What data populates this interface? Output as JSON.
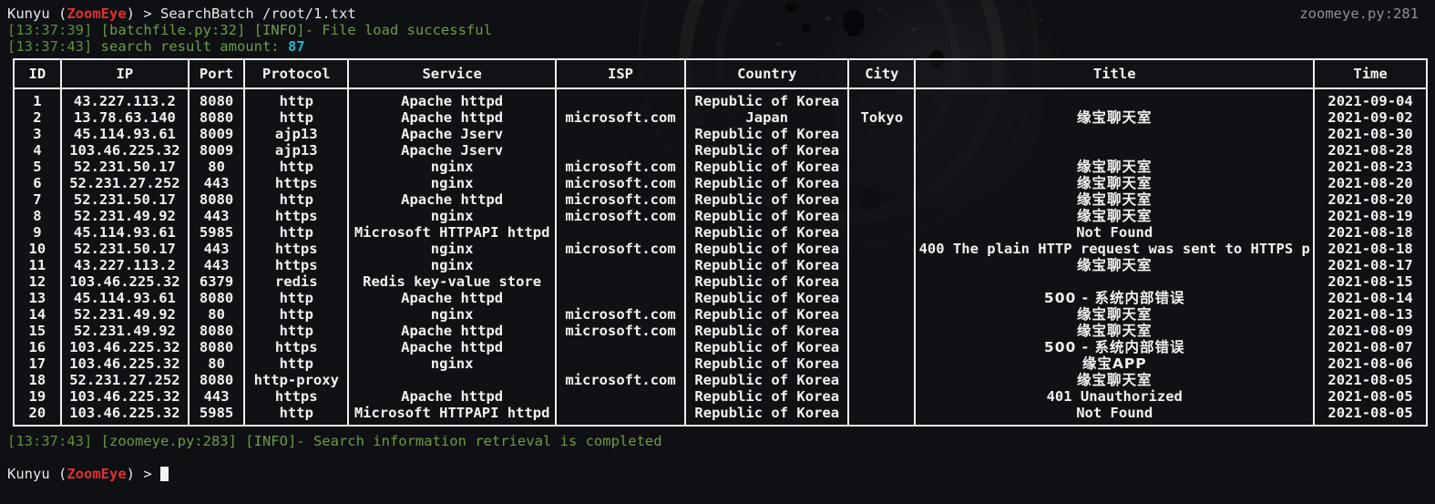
{
  "prompt": {
    "user": "Kunyu",
    "paren_open": " (",
    "brand": "ZoomEye",
    "paren_close": ") ",
    "arrow": "> ",
    "command": "SearchBatch /root/1.txt"
  },
  "log_lines": [
    {
      "time": "[13:37:39]",
      "text": " [batchfile.py:32] [INFO]- File load successful"
    },
    {
      "time": "[13:37:43]",
      "text": " search result amount: ",
      "value": "87"
    }
  ],
  "source_ref": "zoomeye.py:281",
  "table": {
    "headers": [
      "ID",
      "IP",
      "Port",
      "Protocol",
      "Service",
      "ISP",
      "Country",
      "City",
      "Title",
      "Time"
    ],
    "rows": [
      [
        "1",
        "43.227.113.2",
        "8080",
        "http",
        "Apache httpd",
        "",
        "Republic of Korea",
        "",
        "",
        "2021-09-04"
      ],
      [
        "2",
        "13.78.63.140",
        "8080",
        "http",
        "Apache httpd",
        "microsoft.com",
        "Japan",
        "Tokyo",
        "缘宝聊天室",
        "2021-09-02"
      ],
      [
        "3",
        "45.114.93.61",
        "8009",
        "ajp13",
        "Apache Jserv",
        "",
        "Republic of Korea",
        "",
        "",
        "2021-08-30"
      ],
      [
        "4",
        "103.46.225.32",
        "8009",
        "ajp13",
        "Apache Jserv",
        "",
        "Republic of Korea",
        "",
        "",
        "2021-08-28"
      ],
      [
        "5",
        "52.231.50.17",
        "80",
        "http",
        "nginx",
        "microsoft.com",
        "Republic of Korea",
        "",
        "缘宝聊天室",
        "2021-08-23"
      ],
      [
        "6",
        "52.231.27.252",
        "443",
        "https",
        "nginx",
        "microsoft.com",
        "Republic of Korea",
        "",
        "缘宝聊天室",
        "2021-08-20"
      ],
      [
        "7",
        "52.231.50.17",
        "8080",
        "http",
        "Apache httpd",
        "microsoft.com",
        "Republic of Korea",
        "",
        "缘宝聊天室",
        "2021-08-20"
      ],
      [
        "8",
        "52.231.49.92",
        "443",
        "https",
        "nginx",
        "microsoft.com",
        "Republic of Korea",
        "",
        "缘宝聊天室",
        "2021-08-19"
      ],
      [
        "9",
        "45.114.93.61",
        "5985",
        "http",
        "Microsoft HTTPAPI httpd",
        "",
        "Republic of Korea",
        "",
        "Not Found",
        "2021-08-18"
      ],
      [
        "10",
        "52.231.50.17",
        "443",
        "https",
        "nginx",
        "microsoft.com",
        "Republic of Korea",
        "",
        "400 The plain HTTP request was sent to HTTPS p",
        "2021-08-18"
      ],
      [
        "11",
        "43.227.113.2",
        "443",
        "https",
        "nginx",
        "",
        "Republic of Korea",
        "",
        "缘宝聊天室",
        "2021-08-17"
      ],
      [
        "12",
        "103.46.225.32",
        "6379",
        "redis",
        "Redis key-value store",
        "",
        "Republic of Korea",
        "",
        "",
        "2021-08-15"
      ],
      [
        "13",
        "45.114.93.61",
        "8080",
        "http",
        "Apache httpd",
        "",
        "Republic of Korea",
        "",
        "500 - 系统内部错误",
        "2021-08-14"
      ],
      [
        "14",
        "52.231.49.92",
        "80",
        "http",
        "nginx",
        "microsoft.com",
        "Republic of Korea",
        "",
        "缘宝聊天室",
        "2021-08-13"
      ],
      [
        "15",
        "52.231.49.92",
        "8080",
        "http",
        "Apache httpd",
        "microsoft.com",
        "Republic of Korea",
        "",
        "缘宝聊天室",
        "2021-08-09"
      ],
      [
        "16",
        "103.46.225.32",
        "8080",
        "https",
        "Apache httpd",
        "",
        "Republic of Korea",
        "",
        "500 - 系统内部错误",
        "2021-08-07"
      ],
      [
        "17",
        "103.46.225.32",
        "80",
        "http",
        "nginx",
        "",
        "Republic of Korea",
        "",
        "缘宝APP",
        "2021-08-06"
      ],
      [
        "18",
        "52.231.27.252",
        "8080",
        "http-proxy",
        "",
        "microsoft.com",
        "Republic of Korea",
        "",
        "缘宝聊天室",
        "2021-08-05"
      ],
      [
        "19",
        "103.46.225.32",
        "443",
        "https",
        "Apache httpd",
        "",
        "Republic of Korea",
        "",
        "401 Unauthorized",
        "2021-08-05"
      ],
      [
        "20",
        "103.46.225.32",
        "5985",
        "http",
        "Microsoft HTTPAPI httpd",
        "",
        "Republic of Korea",
        "",
        "Not Found",
        "2021-08-05"
      ]
    ]
  },
  "completion_log": {
    "time": "[13:37:43]",
    "text": " [zoomeye.py:283] [INFO]- Search information retrieval is completed"
  },
  "colors": {
    "brand": "#e03030",
    "log_green": "#5f8f3e",
    "count_cyan": "#1fb6cc",
    "source_ref_gray": "#8d9096",
    "background": "#0e1013",
    "text": "#e9e9e9"
  }
}
